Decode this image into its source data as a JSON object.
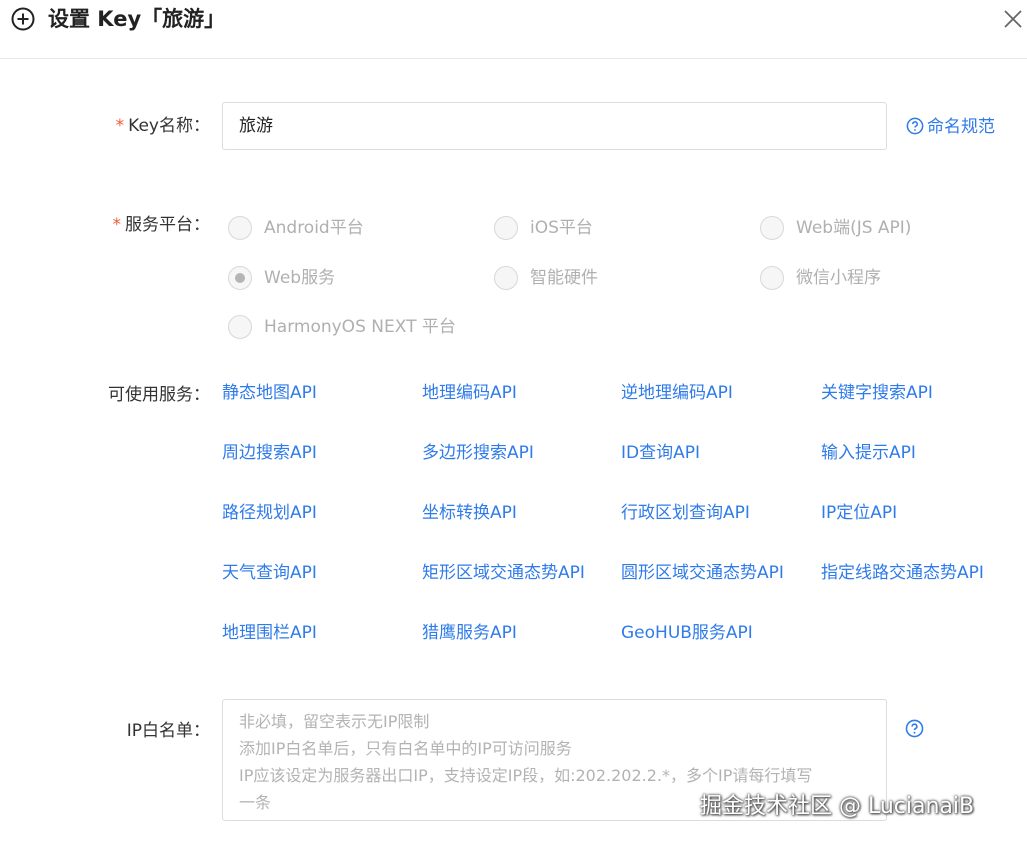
{
  "dialog": {
    "title": "设置 Key「旅游」"
  },
  "key_name": {
    "label": "Key名称：",
    "value": "旅游",
    "help_link": "命名规范"
  },
  "platform": {
    "label": "服务平台：",
    "options": [
      {
        "label": "Android平台",
        "checked": false
      },
      {
        "label": "iOS平台",
        "checked": false
      },
      {
        "label": "Web端(JS API)",
        "checked": false
      },
      {
        "label": "Web服务",
        "checked": true
      },
      {
        "label": "智能硬件",
        "checked": false
      },
      {
        "label": "微信小程序",
        "checked": false
      },
      {
        "label": "HarmonyOS NEXT 平台",
        "checked": false
      }
    ]
  },
  "services": {
    "label": "可使用服务：",
    "items": [
      "静态地图API",
      "地理编码API",
      "逆地理编码API",
      "关键字搜索API",
      "周边搜索API",
      "多边形搜索API",
      "ID查询API",
      "输入提示API",
      "路径规划API",
      "坐标转换API",
      "行政区划查询API",
      "IP定位API",
      "天气查询API",
      "矩形区域交通态势API",
      "圆形区域交通态势API",
      "指定线路交通态势API",
      "地理围栏API",
      "猎鹰服务API",
      "GeoHUB服务API"
    ]
  },
  "ip_whitelist": {
    "label": "IP白名单：",
    "placeholder_lines": [
      "非必填，留空表示无IP限制",
      "添加IP白名单后，只有白名单中的IP可访问服务",
      "IP应该设定为服务器出口IP，支持设定IP段，如:202.202.2.*，多个IP请每行填写",
      "一条"
    ]
  },
  "watermark": "掘金技术社区 @ LucianaiB",
  "colors": {
    "link": "#2f7bea",
    "required": "#f05a3a"
  }
}
